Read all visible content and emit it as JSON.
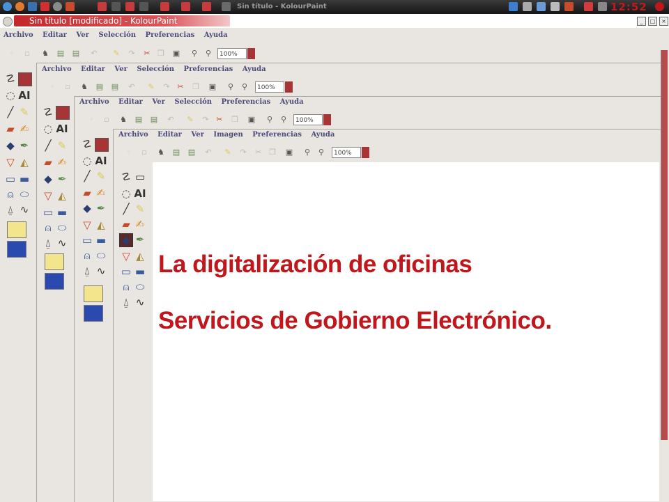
{
  "system_panel": {
    "task_label": "Sin título - KolourPaint",
    "clock": "12:52"
  },
  "window": {
    "title": "Sin título [modificado] - KolourPaint",
    "minimize": "_",
    "maximize": "□",
    "close": "×"
  },
  "menus": {
    "level1": [
      "Archivo",
      "Editar",
      "Ver",
      "Selección",
      "Preferencias",
      "Ayuda"
    ],
    "level2": [
      "Archivo",
      "Editar",
      "Ver",
      "Selección",
      "Preferencias",
      "Ayuda"
    ],
    "level3": [
      "Archivo",
      "Editar",
      "Ver",
      "Selección",
      "Preferencias",
      "Ayuda"
    ],
    "level4": [
      "Archivo",
      "Editar",
      "Ver",
      "Imagen",
      "Preferencias",
      "Ayuda"
    ]
  },
  "zoom_value": "100%",
  "canvas": {
    "line1": "La digitalización de oficinas",
    "line2": "Servicios de Gobierno Electrónico."
  },
  "colors": {
    "accent": "#c0171d",
    "title_gradient_start": "#c3282a",
    "zoom_button": "#a83536"
  },
  "icons": {
    "tools": [
      "free-select-icon",
      "rect-select-icon",
      "ellipse-select-icon",
      "text-icon",
      "line-icon",
      "pen-icon",
      "eraser-icon",
      "brush-icon",
      "fill-icon",
      "color-picker-icon",
      "zoom-icon",
      "spraycan-icon",
      "rectangle-icon",
      "rounded-rect-icon",
      "polygon-icon",
      "ellipse-icon",
      "polyline-icon",
      "curve-icon"
    ],
    "toolbar": [
      "new-icon",
      "open-icon",
      "save-icon",
      "print-icon",
      "export-icon",
      "undo-icon",
      "redo-icon",
      "cut-icon",
      "copy-icon",
      "paste-icon",
      "zoom-in-icon",
      "zoom-out-icon"
    ]
  }
}
